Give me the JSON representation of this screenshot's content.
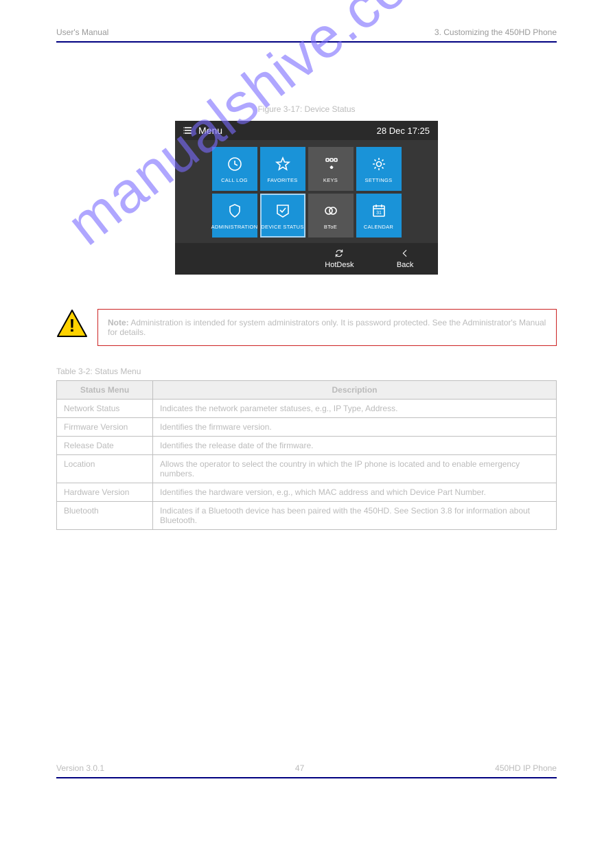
{
  "header": {
    "left": "User's Manual",
    "right": "3. Customizing the 450HD Phone"
  },
  "figure_caption": "Figure 3-17: Device Status",
  "device": {
    "menu_label": "Menu",
    "datetime": "28 Dec 17:25",
    "tiles": [
      {
        "name": "call-log",
        "label": "CALL LOG",
        "icon": "clock",
        "style": "blue"
      },
      {
        "name": "favorites",
        "label": "FAVORITES",
        "icon": "star",
        "style": "blue"
      },
      {
        "name": "keys",
        "label": "KEYS",
        "icon": "keys",
        "style": "gray"
      },
      {
        "name": "settings",
        "label": "SETTINGS",
        "icon": "gear",
        "style": "blue"
      },
      {
        "name": "administration",
        "label": "ADMINISTRATION",
        "icon": "shield",
        "style": "blue"
      },
      {
        "name": "device-status",
        "label": "DEVICE STATUS",
        "icon": "check",
        "style": "blue",
        "selected": true
      },
      {
        "name": "btoe",
        "label": "BToE",
        "icon": "link",
        "style": "gray"
      },
      {
        "name": "calendar",
        "label": "CALENDAR",
        "icon": "calendar",
        "style": "blue"
      }
    ],
    "softkeys": {
      "left_blank_1": "",
      "left_blank_2": "",
      "hotdesk": "HotDesk",
      "back": "Back"
    }
  },
  "note": {
    "label": "Note:",
    "text": " Administration is intended for system administrators only. It is password protected. See the Administrator's Manual for details."
  },
  "table_caption": "Table 3-2: Status Menu",
  "table": {
    "head": {
      "col1": "Status Menu",
      "col2": "Description"
    },
    "rows": [
      {
        "name": "Network Status",
        "desc": "Indicates the network parameter statuses, e.g., IP Type, Address."
      },
      {
        "name": "Firmware Version",
        "desc": "Identifies the firmware version."
      },
      {
        "name": "Release Date",
        "desc": "Identifies the release date of the firmware."
      },
      {
        "name": "Location",
        "desc": "Allows the operator to select the country in which the IP phone is located and to enable emergency numbers."
      },
      {
        "name": "Hardware Version",
        "desc": "Identifies the hardware version, e.g., which MAC address and which Device Part Number."
      },
      {
        "name": "Bluetooth",
        "desc": "Indicates if a Bluetooth device has been paired with the 450HD. See Section 3.8 for information about Bluetooth."
      }
    ]
  },
  "footer": {
    "left": "Version 3.0.1",
    "center": "47",
    "right": "450HD IP Phone"
  },
  "watermark": "manualshive.com"
}
